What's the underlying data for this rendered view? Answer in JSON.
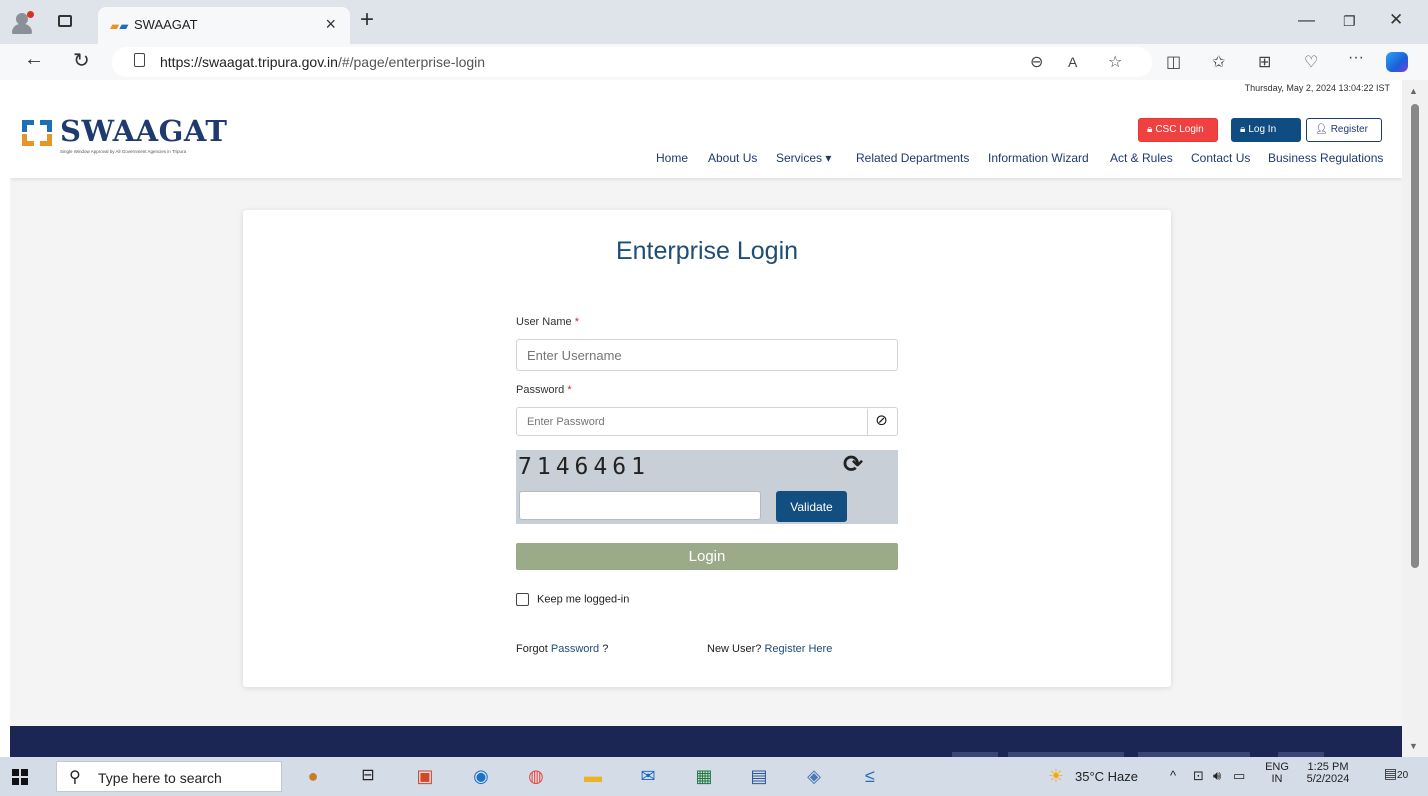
{
  "browser": {
    "tab_title": "SWAAGAT",
    "tab_close": "×",
    "new_tab": "+",
    "url_host": "https://swaagat.tripura.gov.in",
    "url_path": "/#/page/enterprise-login",
    "icons": [
      "profile-icon",
      "tab-actions-icon",
      "back-icon",
      "refresh-icon",
      "lock-icon",
      "zoom-icon",
      "read-aloud-icon",
      "favorite-icon",
      "split-screen-icon",
      "favorites-icon",
      "collections-icon",
      "browser-essentials-icon",
      "more-icon",
      "copilot-icon"
    ]
  },
  "site": {
    "datetime": "Thursday, May 2, 2024 13:04:22 IST",
    "logo_word": "SWAAGAT",
    "logo_tagline": "Single Window Approval by All Government Agencies in Tripura",
    "csc_login": "CSC Login",
    "log_in": "Log In",
    "register": "Register",
    "nav": [
      "Home",
      "About Us",
      "Services ▾",
      "Related Departments",
      "Information Wizard",
      "Act & Rules",
      "Contact Us",
      "Business Regulations"
    ],
    "colors": {
      "navy": "#1e3a6e",
      "csc_red": "#f04141",
      "login_blue": "#0f4c81",
      "footer": "#1b2654",
      "login_green": "#9bab8a",
      "logo_orange": "#e6952b"
    }
  },
  "login": {
    "title": "Enterprise Login",
    "username_label": "User Name",
    "username_placeholder": "Enter Username",
    "password_label": "Password",
    "password_placeholder": "Enter Password",
    "required_mark": "*",
    "captcha": "7146461",
    "validate": "Validate",
    "submit": "Login",
    "keep_logged": "Keep me logged-in",
    "forgot_prefix": "Forgot",
    "forgot_link": "Password",
    "forgot_suffix": "?",
    "new_user": "New User?",
    "register_here": "Register Here"
  },
  "taskbar": {
    "search_placeholder": "Type here to search",
    "weather": "35°C  Haze",
    "lang_top": "ENG",
    "lang_bottom": "IN",
    "time": "1:25 PM",
    "date": "5/2/2024",
    "notifications": "20"
  }
}
